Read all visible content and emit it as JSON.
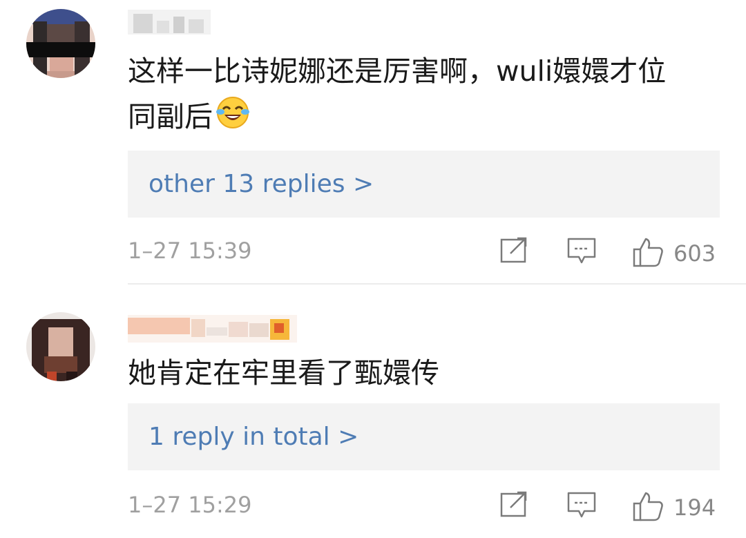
{
  "comments": [
    {
      "text_line1": "这样一比诗妮娜还是厉害啊，wuli嬛嬛才位",
      "text_line2": "同副后",
      "emoji_icon": "laughing-crying-emoji",
      "replies_label": "other 13 replies >",
      "time": "1–27 15:39",
      "like_count": "603"
    },
    {
      "text_line1": "她肯定在牢里看了甄嬛传",
      "replies_label": "1 reply in total >",
      "time": "1–27 15:29",
      "like_count": "194"
    }
  ],
  "colors": {
    "link": "#4e7cb4",
    "reply_box_bg": "#f3f3f3",
    "meta_gray": "#a0a0a0",
    "text": "#1a1a1a"
  }
}
